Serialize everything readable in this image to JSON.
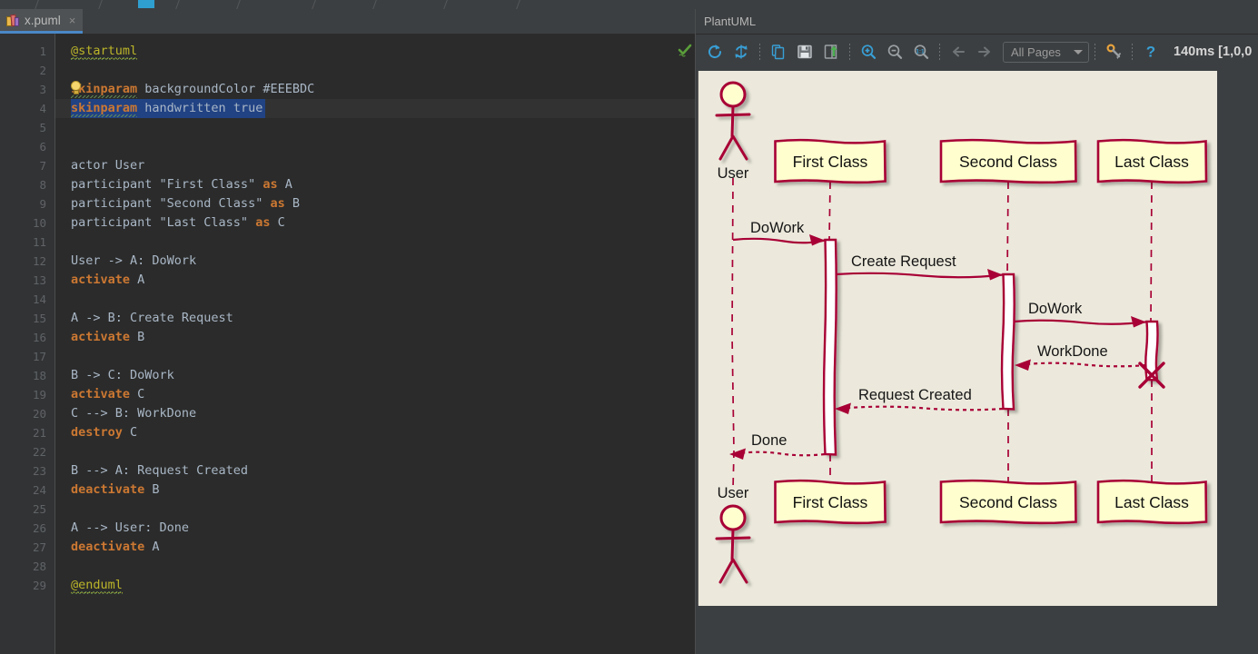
{
  "window": {
    "top_nav_partial": true
  },
  "editor": {
    "tab": {
      "title": "x.puml",
      "close_label": "×",
      "icon": "puml-file-icon"
    },
    "selected_line": 4,
    "caret_line": 4,
    "gutter_line_numbers": [
      1,
      2,
      3,
      4,
      5,
      6,
      7,
      8,
      9,
      10,
      11,
      12,
      13,
      14,
      15,
      16,
      17,
      18,
      19,
      20,
      21,
      22,
      23,
      24,
      25,
      26,
      27,
      28,
      29
    ],
    "lines": [
      {
        "n": 1,
        "segments": [
          {
            "t": "@startuml",
            "c": "tagu"
          }
        ]
      },
      {
        "n": 2,
        "segments": []
      },
      {
        "n": 3,
        "segments": [
          {
            "t": "skinparam",
            "c": "kw"
          },
          {
            "t": " backgroundColor #EEEBDC",
            "c": "txt"
          }
        ]
      },
      {
        "n": 4,
        "segments": [
          {
            "t": "skinparam",
            "c": "kw"
          },
          {
            "t": " handwritten true",
            "c": "txt"
          }
        ]
      },
      {
        "n": 5,
        "segments": []
      },
      {
        "n": 6,
        "segments": []
      },
      {
        "n": 7,
        "segments": [
          {
            "t": "actor User",
            "c": "txt"
          }
        ]
      },
      {
        "n": 8,
        "segments": [
          {
            "t": "participant \"First Class\" ",
            "c": "txt"
          },
          {
            "t": "as",
            "c": "kw"
          },
          {
            "t": " A",
            "c": "txt"
          }
        ]
      },
      {
        "n": 9,
        "segments": [
          {
            "t": "participant \"Second Class\" ",
            "c": "txt"
          },
          {
            "t": "as",
            "c": "kw"
          },
          {
            "t": " B",
            "c": "txt"
          }
        ]
      },
      {
        "n": 10,
        "segments": [
          {
            "t": "participant \"Last Class\" ",
            "c": "txt"
          },
          {
            "t": "as",
            "c": "kw"
          },
          {
            "t": " C",
            "c": "txt"
          }
        ]
      },
      {
        "n": 11,
        "segments": []
      },
      {
        "n": 12,
        "segments": [
          {
            "t": "User -> A: DoWork",
            "c": "txt"
          }
        ]
      },
      {
        "n": 13,
        "segments": [
          {
            "t": "activate",
            "c": "kw"
          },
          {
            "t": " A",
            "c": "txt"
          }
        ]
      },
      {
        "n": 14,
        "segments": []
      },
      {
        "n": 15,
        "segments": [
          {
            "t": "A -> B: Create Request",
            "c": "txt"
          }
        ]
      },
      {
        "n": 16,
        "segments": [
          {
            "t": "activate",
            "c": "kw"
          },
          {
            "t": " B",
            "c": "txt"
          }
        ]
      },
      {
        "n": 17,
        "segments": []
      },
      {
        "n": 18,
        "segments": [
          {
            "t": "B -> C: DoWork",
            "c": "txt"
          }
        ]
      },
      {
        "n": 19,
        "segments": [
          {
            "t": "activate",
            "c": "kw"
          },
          {
            "t": " C",
            "c": "txt"
          }
        ]
      },
      {
        "n": 20,
        "segments": [
          {
            "t": "C --> B: WorkDone",
            "c": "txt"
          }
        ]
      },
      {
        "n": 21,
        "segments": [
          {
            "t": "destroy",
            "c": "kw"
          },
          {
            "t": " C",
            "c": "txt"
          }
        ]
      },
      {
        "n": 22,
        "segments": []
      },
      {
        "n": 23,
        "segments": [
          {
            "t": "B --> A: Request Created",
            "c": "txt"
          }
        ]
      },
      {
        "n": 24,
        "segments": [
          {
            "t": "deactivate",
            "c": "kw"
          },
          {
            "t": " B",
            "c": "txt"
          }
        ]
      },
      {
        "n": 25,
        "segments": []
      },
      {
        "n": 26,
        "segments": [
          {
            "t": "A --> User: Done",
            "c": "txt"
          }
        ]
      },
      {
        "n": 27,
        "segments": [
          {
            "t": "deactivate",
            "c": "kw"
          },
          {
            "t": " A",
            "c": "txt"
          }
        ]
      },
      {
        "n": 28,
        "segments": []
      },
      {
        "n": 29,
        "segments": [
          {
            "t": "@enduml",
            "c": "tagu"
          }
        ]
      }
    ],
    "intention_bulb_icon": "lightbulb-icon",
    "inspection_status_icon": "green-check-icon"
  },
  "uml_panel": {
    "title": "PlantUML",
    "toolbar": [
      {
        "name": "refresh-button",
        "icon": "refresh-icon",
        "label": "Refresh"
      },
      {
        "name": "reload-button",
        "icon": "sync-icon",
        "label": "Reload"
      },
      {
        "name": "copy-button",
        "icon": "copy-icon",
        "label": "Copy to clipboard"
      },
      {
        "name": "save-button",
        "icon": "floppy-save-icon",
        "label": "Save"
      },
      {
        "name": "export-button",
        "icon": "export-icon",
        "label": "Export"
      },
      {
        "name": "zoom-in-button",
        "icon": "zoom-in-icon",
        "label": "Zoom in"
      },
      {
        "name": "zoom-out-button",
        "icon": "zoom-out-icon",
        "label": "Zoom out"
      },
      {
        "name": "zoom-actual-button",
        "icon": "zoom-actual-size-icon",
        "label": "Actual size 1:1"
      },
      {
        "name": "prev-page-button",
        "icon": "arrow-left-icon",
        "label": "Previous page"
      },
      {
        "name": "next-page-button",
        "icon": "arrow-right-icon",
        "label": "Next page"
      },
      {
        "name": "settings-button",
        "icon": "wrench-gear-icon",
        "label": "Settings"
      },
      {
        "name": "help-button",
        "icon": "question-mark-icon",
        "label": "Help"
      }
    ],
    "pages_dropdown": {
      "value": "All Pages",
      "options": [
        "All Pages"
      ]
    },
    "status": "140ms [1,0,0"
  },
  "diagram": {
    "type": "sequence",
    "style": "handwritten",
    "background": "#ECE9DC",
    "stroke": "#A80036",
    "box_fill": "#FEFECE",
    "participants": [
      {
        "id": "User",
        "label": "User",
        "kind": "actor"
      },
      {
        "id": "A",
        "label": "First Class",
        "kind": "participant"
      },
      {
        "id": "B",
        "label": "Second Class",
        "kind": "participant"
      },
      {
        "id": "C",
        "label": "Last Class",
        "kind": "participant"
      }
    ],
    "messages": [
      {
        "from": "User",
        "to": "A",
        "label": "DoWork",
        "dashed": false
      },
      {
        "from": "A",
        "to": "B",
        "label": "Create Request",
        "dashed": false
      },
      {
        "from": "B",
        "to": "C",
        "label": "DoWork",
        "dashed": false
      },
      {
        "from": "C",
        "to": "B",
        "label": "WorkDone",
        "dashed": true
      },
      {
        "from": "B",
        "to": "A",
        "label": "Request Created",
        "dashed": true
      },
      {
        "from": "A",
        "to": "User",
        "label": "Done",
        "dashed": true
      }
    ],
    "destroyed": [
      "C"
    ]
  }
}
